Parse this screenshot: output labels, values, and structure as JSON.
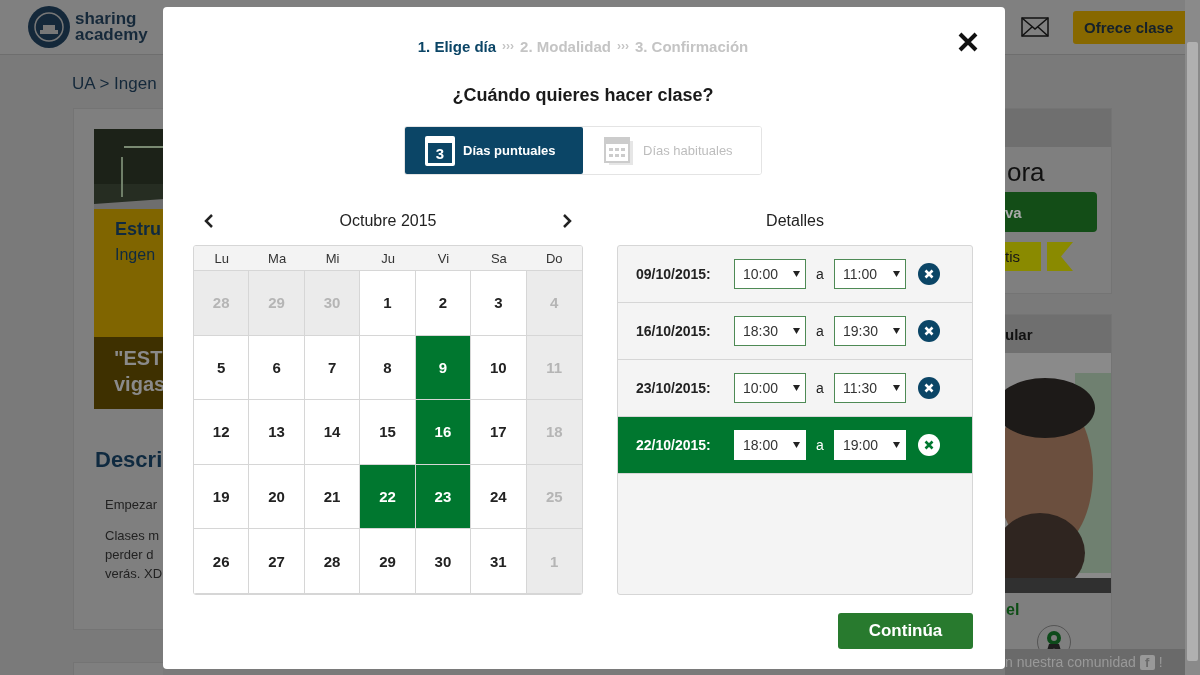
{
  "background": {
    "logo": {
      "line1": "sharing",
      "line2": "academy"
    },
    "header_button": "Ofrece clase",
    "breadcrumb": "UA > Ingen",
    "course_card": {
      "title": "Estru",
      "subtitle": "Ingen",
      "quote_lines": [
        "\"EST",
        "vigas"
      ]
    },
    "description": {
      "heading": "Descri",
      "paragraphs": [
        [
          "Empezar"
        ],
        [
          "Clases m",
          "perder d",
          "verás. XD"
        ]
      ]
    },
    "price_card": {
      "price": "ora",
      "book_button": "va",
      "tag": "tis"
    },
    "teacher_card": {
      "header": "ular",
      "name_link": "el"
    },
    "community_bar": {
      "text": "n nuestra comunidad",
      "fb": "f",
      "suffix": "!"
    }
  },
  "modal": {
    "steps": [
      {
        "label": "1. Elige día",
        "selected": true
      },
      {
        "separator": "›››",
        "label": "2. Modalidad",
        "selected": false
      },
      {
        "separator": "›››",
        "label": "3. Confirmación",
        "selected": false
      }
    ],
    "question": "¿Cuándo quieres hacer clase?",
    "modes": [
      {
        "kind": "single",
        "label": "Días puntuales",
        "icon_number": "3",
        "selected": true
      },
      {
        "kind": "recurring",
        "label": "Días habituales",
        "selected": false
      }
    ],
    "calendar": {
      "month": "Octubre 2015",
      "weekdays": [
        "Lu",
        "Ma",
        "Mi",
        "Ju",
        "Vi",
        "Sa",
        "Do"
      ],
      "weeks": [
        [
          {
            "day": "28",
            "disabled": true,
            "selected": false
          },
          {
            "day": "29",
            "disabled": true,
            "selected": false
          },
          {
            "day": "30",
            "disabled": true,
            "selected": false
          },
          {
            "day": "1",
            "disabled": false,
            "selected": false
          },
          {
            "day": "2",
            "disabled": false,
            "selected": false
          },
          {
            "day": "3",
            "disabled": false,
            "selected": false
          },
          {
            "day": "4",
            "disabled": true,
            "selected": false
          }
        ],
        [
          {
            "day": "5",
            "disabled": false,
            "selected": false
          },
          {
            "day": "6",
            "disabled": false,
            "selected": false
          },
          {
            "day": "7",
            "disabled": false,
            "selected": false
          },
          {
            "day": "8",
            "disabled": false,
            "selected": false
          },
          {
            "day": "9",
            "disabled": false,
            "selected": true
          },
          {
            "day": "10",
            "disabled": false,
            "selected": false
          },
          {
            "day": "11",
            "disabled": true,
            "selected": false
          }
        ],
        [
          {
            "day": "12",
            "disabled": false,
            "selected": false
          },
          {
            "day": "13",
            "disabled": false,
            "selected": false
          },
          {
            "day": "14",
            "disabled": false,
            "selected": false
          },
          {
            "day": "15",
            "disabled": false,
            "selected": false
          },
          {
            "day": "16",
            "disabled": false,
            "selected": true
          },
          {
            "day": "17",
            "disabled": false,
            "selected": false
          },
          {
            "day": "18",
            "disabled": true,
            "selected": false
          }
        ],
        [
          {
            "day": "19",
            "disabled": false,
            "selected": false
          },
          {
            "day": "20",
            "disabled": false,
            "selected": false
          },
          {
            "day": "21",
            "disabled": false,
            "selected": false
          },
          {
            "day": "22",
            "disabled": false,
            "selected": true
          },
          {
            "day": "23",
            "disabled": false,
            "selected": true
          },
          {
            "day": "24",
            "disabled": false,
            "selected": false
          },
          {
            "day": "25",
            "disabled": true,
            "selected": false
          }
        ],
        [
          {
            "day": "26",
            "disabled": false,
            "selected": false
          },
          {
            "day": "27",
            "disabled": false,
            "selected": false
          },
          {
            "day": "28",
            "disabled": false,
            "selected": false
          },
          {
            "day": "29",
            "disabled": false,
            "selected": false
          },
          {
            "day": "30",
            "disabled": false,
            "selected": false
          },
          {
            "day": "31",
            "disabled": false,
            "selected": false
          },
          {
            "day": "1",
            "disabled": true,
            "selected": false
          }
        ]
      ]
    },
    "details": {
      "title": "Detalles",
      "rows": [
        {
          "date": "09/10/2015:",
          "from": "10:00",
          "separator": "a",
          "to": "11:00",
          "selected": false
        },
        {
          "date": "16/10/2015:",
          "from": "18:30",
          "separator": "a",
          "to": "19:30",
          "selected": false
        },
        {
          "date": "23/10/2015:",
          "from": "10:00",
          "separator": "a",
          "to": "11:30",
          "selected": false
        },
        {
          "date": "22/10/2015:",
          "from": "18:00",
          "separator": "a",
          "to": "19:00",
          "selected": true
        }
      ]
    },
    "continue_button": "Continúa"
  }
}
